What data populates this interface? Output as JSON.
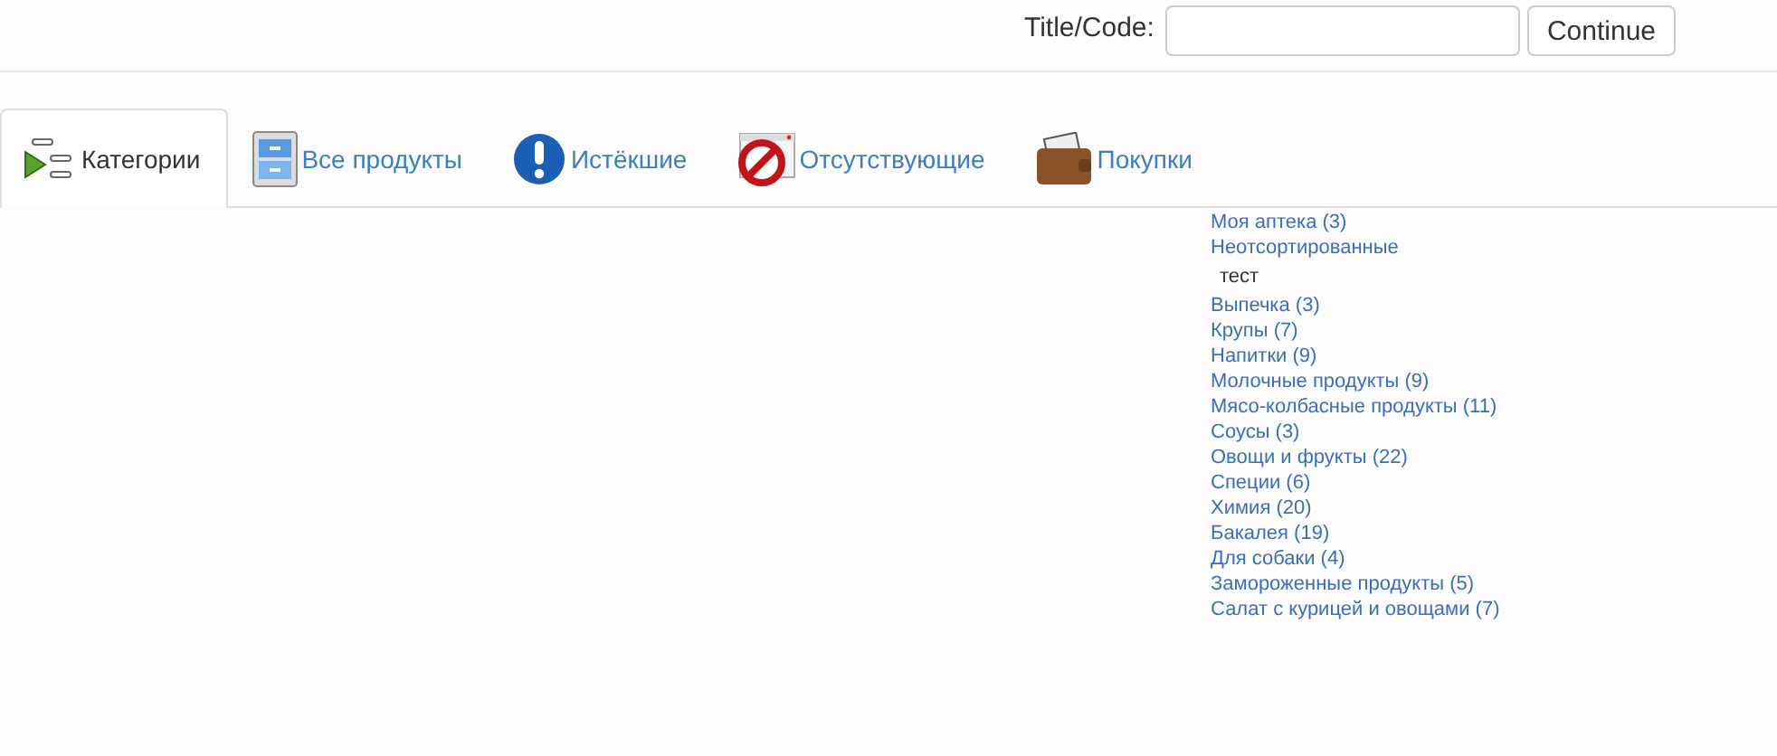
{
  "search": {
    "label": "Title/Code:",
    "button": "Continue"
  },
  "tabs": [
    {
      "label": "Категории",
      "kind": "tree",
      "selected": true
    },
    {
      "label": "Все продукты",
      "kind": "cabinet",
      "selected": false
    },
    {
      "label": "Истёкшие",
      "kind": "alert",
      "selected": false
    },
    {
      "label": "Отсутствующие",
      "kind": "forbidden",
      "selected": false
    },
    {
      "label": "Покупки",
      "kind": "wallet",
      "selected": false
    }
  ],
  "categories": [
    {
      "label": "Моя аптека (3)"
    },
    {
      "label": "Неотсортированные",
      "children": [
        {
          "label": "тест"
        }
      ]
    },
    {
      "label": "Выпечка (3)"
    },
    {
      "label": "Крупы (7)"
    },
    {
      "label": "Напитки (9)"
    },
    {
      "label": "Молочные продукты (9)"
    },
    {
      "label": "Мясо-колбасные продукты (11)"
    },
    {
      "label": "Соусы (3)"
    },
    {
      "label": "Овощи и фрукты (22)"
    },
    {
      "label": "Специи (6)"
    },
    {
      "label": "Химия (20)"
    },
    {
      "label": "Бакалея (19)"
    },
    {
      "label": "Для собаки (4)"
    },
    {
      "label": "Замороженные продукты (5)"
    },
    {
      "label": "Салат с курицей и овощами (7)"
    }
  ]
}
